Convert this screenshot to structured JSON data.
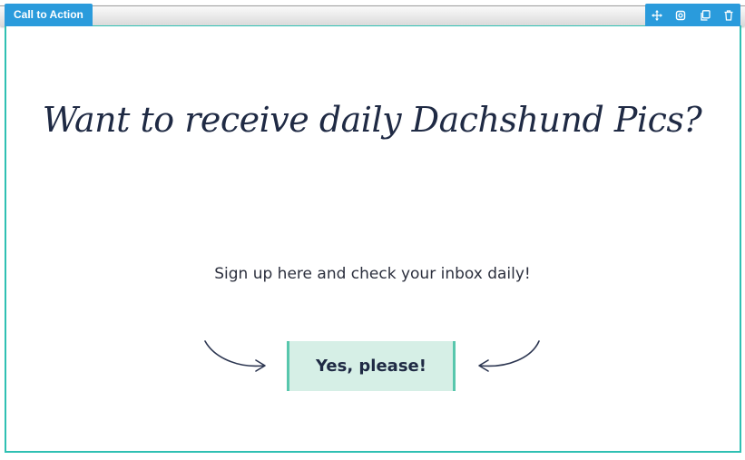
{
  "builder": {
    "module_label": "Call to Action",
    "tools": [
      {
        "icon": "move-icon"
      },
      {
        "icon": "settings-icon"
      },
      {
        "icon": "duplicate-icon"
      },
      {
        "icon": "delete-icon"
      }
    ]
  },
  "cta": {
    "headline": "Want to receive daily Dachshund Pics?",
    "subtext": "Sign up here and check your inbox daily!",
    "button_label": "Yes, please!"
  },
  "colors": {
    "accent_blue": "#2a9bdc",
    "frame_teal": "#2fc0b3",
    "button_bg": "#d6efe6",
    "button_border": "#58c7ad",
    "text_dark": "#1f2a44"
  }
}
